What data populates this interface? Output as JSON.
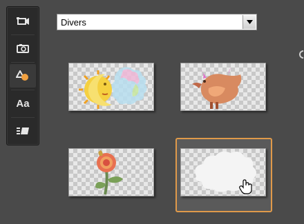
{
  "dropdown": {
    "value": "Divers"
  },
  "toolbar": {
    "items": [
      {
        "icon": "video-icon",
        "active": false
      },
      {
        "icon": "camera-icon",
        "active": false
      },
      {
        "icon": "shapes-icon",
        "active": true
      },
      {
        "label": "Aa",
        "icon": "text-icon",
        "active": false
      },
      {
        "icon": "transition-icon",
        "active": false
      }
    ]
  },
  "thumbnails": [
    {
      "name": "sun-moon-cloud",
      "selected": false
    },
    {
      "name": "bird",
      "selected": false
    },
    {
      "name": "flower",
      "selected": false
    },
    {
      "name": "white-cloud",
      "selected": true
    }
  ],
  "colors": {
    "accent": "#e09a4a",
    "panel": "#4a4a4a",
    "toolbar": "#2a2a2a"
  }
}
